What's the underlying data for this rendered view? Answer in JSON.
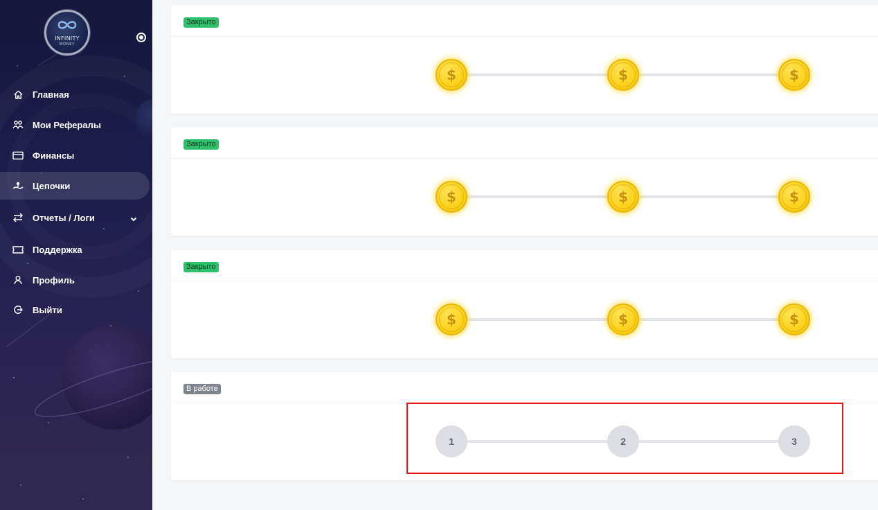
{
  "logo": {
    "title": "INFINITY",
    "subtitle": "MONEY"
  },
  "sidebar": {
    "items": [
      {
        "label": "Главная",
        "icon": "home-icon"
      },
      {
        "label": "Мои Рефералы",
        "icon": "referrals-icon"
      },
      {
        "label": "Финансы",
        "icon": "card-icon"
      },
      {
        "label": "Цепочки",
        "icon": "chain-icon",
        "active": true
      },
      {
        "label": "Отчеты / Логи",
        "icon": "transfer-icon",
        "expandable": true
      },
      {
        "label": "Поддержка",
        "icon": "ticket-icon"
      },
      {
        "label": "Профиль",
        "icon": "user-icon"
      },
      {
        "label": "Выйти",
        "icon": "logout-icon"
      }
    ]
  },
  "chains": [
    {
      "status": "Закрыто",
      "status_type": "closed",
      "steps": [
        "$",
        "$",
        "$"
      ]
    },
    {
      "status": "Закрыто",
      "status_type": "closed",
      "steps": [
        "$",
        "$",
        "$"
      ]
    },
    {
      "status": "Закрыто",
      "status_type": "closed",
      "steps": [
        "$",
        "$",
        "$"
      ]
    },
    {
      "status": "В работе",
      "status_type": "work",
      "steps": [
        "1",
        "2",
        "3"
      ]
    }
  ],
  "colors": {
    "sidebar_bg": "#1d1d4c",
    "badge_closed": "#2ec06a",
    "badge_work": "#7f858d",
    "coin": "#fbd21d",
    "highlight": "#e31616"
  }
}
